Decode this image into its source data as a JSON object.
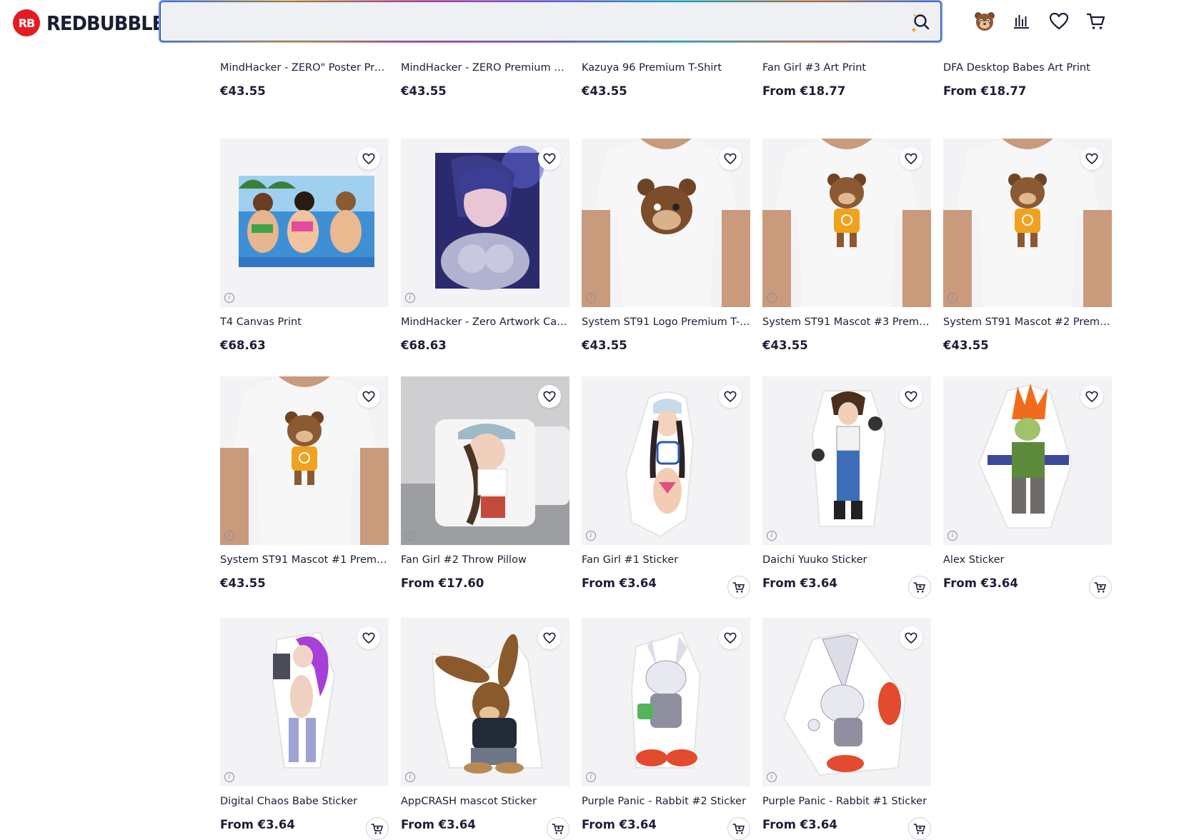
{
  "header": {
    "logo_mark": "RB",
    "logo_text": "REDBUBBLE",
    "search": {
      "value": "",
      "placeholder": ""
    },
    "icons": [
      "account-avatar-icon",
      "artist-dashboard-icon",
      "heart-icon",
      "cart-icon"
    ]
  },
  "colors": {
    "accent": "#e31b23",
    "text": "#1c1d35",
    "card_bg": "#f3f3f5"
  },
  "rows": [
    {
      "partial": true,
      "items": [
        {
          "title": "MindHacker - ZERO\" Poster Prem...",
          "price": "€43.55",
          "art": "tshirt-dark",
          "cart": false
        },
        {
          "title": "MindHacker - ZERO Premium T-S...",
          "price": "€43.55",
          "art": "tshirt-dark",
          "cart": false
        },
        {
          "title": "Kazuya 96 Premium T-Shirt",
          "price": "€43.55",
          "art": "tshirt-dark",
          "cart": false
        },
        {
          "title": "Fan Girl #3 Art Print",
          "price": "From €18.77",
          "art": "blank",
          "cart": false
        },
        {
          "title": "DFA Desktop Babes Art Print",
          "price": "From €18.77",
          "art": "blank",
          "cart": false
        }
      ]
    },
    {
      "partial": false,
      "items": [
        {
          "title": "T4 Canvas Print",
          "price": "€68.63",
          "art": "canvas-wide",
          "cart": false
        },
        {
          "title": "MindHacker - Zero Artwork Canv...",
          "price": "€68.63",
          "art": "canvas-tall",
          "cart": false
        },
        {
          "title": "System ST91 Logo Premium T-Sh...",
          "price": "€43.55",
          "art": "tshirt-bear",
          "cart": false
        },
        {
          "title": "System ST91 Mascot #3 Premiu...",
          "price": "€43.55",
          "art": "tshirt-mascot",
          "cart": false
        },
        {
          "title": "System ST91 Mascot #2 Premiu...",
          "price": "€43.55",
          "art": "tshirt-mascot",
          "cart": false
        }
      ]
    },
    {
      "partial": false,
      "items": [
        {
          "title": "System ST91 Mascot #1 Premium...",
          "price": "€43.55",
          "art": "tshirt-mascot",
          "cart": false
        },
        {
          "title": "Fan Girl #2 Throw Pillow",
          "price": "From €17.60",
          "art": "pillow",
          "cart": false
        },
        {
          "title": "Fan Girl #1 Sticker",
          "price": "From €3.64",
          "art": "sticker-girl",
          "cart": true
        },
        {
          "title": "Daichi Yuuko Sticker",
          "price": "From €3.64",
          "art": "sticker-fighter",
          "cart": true
        },
        {
          "title": "Alex Sticker",
          "price": "From €3.64",
          "art": "sticker-alex",
          "cart": true
        }
      ]
    },
    {
      "partial": false,
      "items": [
        {
          "title": "Digital Chaos Babe Sticker",
          "price": "From €3.64",
          "art": "sticker-purple",
          "cart": true
        },
        {
          "title": "AppCRASH mascot Sticker",
          "price": "From €3.64",
          "art": "sticker-rabbit-brown",
          "cart": true
        },
        {
          "title": "Purple Panic - Rabbit #2 Sticker",
          "price": "From €3.64",
          "art": "sticker-rabbit-white",
          "cart": true
        },
        {
          "title": "Purple Panic - Rabbit #1 Sticker",
          "price": "From €3.64",
          "art": "sticker-rabbit-white2",
          "cart": true
        }
      ]
    }
  ]
}
